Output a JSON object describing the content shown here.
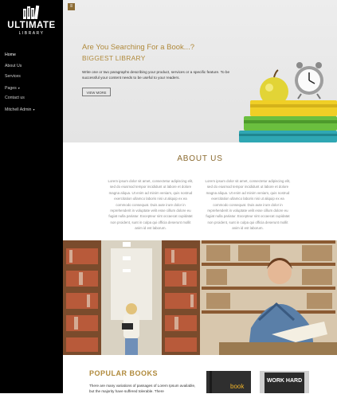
{
  "brand": {
    "title": "ULTIMATE",
    "subtitle": "LIBRARY"
  },
  "nav": [
    {
      "label": "Home",
      "caret": ""
    },
    {
      "label": "About Us",
      "caret": ""
    },
    {
      "label": "Services",
      "caret": ""
    },
    {
      "label": "Pages",
      "caret": "▾"
    },
    {
      "label": "Contact us",
      "caret": ""
    },
    {
      "label": "Mitchell Admin",
      "caret": "▾"
    }
  ],
  "hero": {
    "menu_icon": "hamburger-icon",
    "title": "Are You Searching For a Book...?",
    "subtitle": "BIGGEST LIBRARY",
    "paragraph": "Write one or two paragraphs describing your product, services or a specific feature. To be successful your content needs to be useful to your readers.",
    "button": "VIEW MORE"
  },
  "about": {
    "title": "ABOUT US",
    "col1": "Lorem ipsum dolor sit amet, consectetur adipiscing elit, sed do eiusmod tempor incididunt ut labore et dolore magna aliqua. Ut enim ad minim veniam, quis nostrud exercitation ullamco laboris nisi ut aliquip ex ea commodo consequat. Duis aute irure dolor in reprehenderit in voluptate velit esse cillum dolore eu fugiat nulla pariatur. Excepteur sint occaecat cupidatat non proident, sunt in culpa qui officia deserunt mollit anim id est laborum.",
    "col2": "Lorem ipsum dolor sit amet, consectetur adipiscing elit, sed do eiusmod tempor incididunt ut labore et dolore magna aliqua. Ut enim ad minim veniam, quis nostrud exercitation ullamco laboris nisi ut aliquip ex ea commodo consequat. Duis aute irure dolor in reprehenderit in voluptate velit esse cillum dolore eu fugiat nulla pariatur. Excepteur sint occaecat cupidatat non proident, sunt in culpa qui officia deserunt mollit anim id est laborum."
  },
  "popular": {
    "title": "POPULAR BOOKS",
    "paragraph": "There are many variations of passages of Lorem Ipsum available, but the majority have suffered tolerable. There",
    "book1_label": "book",
    "book2_label": "WORK HARD"
  },
  "colors": {
    "accent": "#b08a3c",
    "sidebar": "#000000"
  }
}
